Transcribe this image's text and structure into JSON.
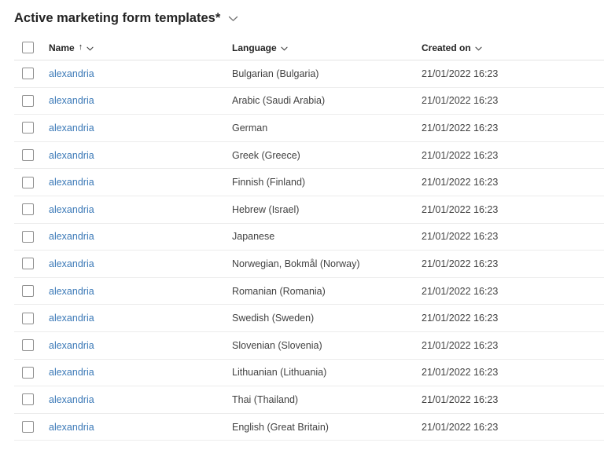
{
  "header": {
    "title": "Active marketing form templates*",
    "view_selector_icon": "chevron-down"
  },
  "icons": {
    "sort_ascending_glyph": "↑",
    "chevron_down_name": "chevron-down"
  },
  "colors": {
    "title_text": "#242424",
    "header_text": "#242424",
    "cell_text": "#424242",
    "link": "#3b79b7",
    "row_divider": "#ececec",
    "header_divider": "#e3e3e3",
    "checkbox_border": "#8f8f8f",
    "background": "#ffffff"
  },
  "table": {
    "select_all_checked": false,
    "columns": [
      {
        "id": "name",
        "label": "Name",
        "sorted": "ascending",
        "has_menu": true
      },
      {
        "id": "language",
        "label": "Language",
        "has_menu": true
      },
      {
        "id": "created_on",
        "label": "Created on",
        "has_menu": true
      }
    ],
    "rows": [
      {
        "name": "alexandria",
        "language": "Bulgarian (Bulgaria)",
        "created_on": "21/01/2022 16:23"
      },
      {
        "name": "alexandria",
        "language": "Arabic (Saudi Arabia)",
        "created_on": "21/01/2022 16:23"
      },
      {
        "name": "alexandria",
        "language": "German",
        "created_on": "21/01/2022 16:23"
      },
      {
        "name": "alexandria",
        "language": "Greek (Greece)",
        "created_on": "21/01/2022 16:23"
      },
      {
        "name": "alexandria",
        "language": "Finnish (Finland)",
        "created_on": "21/01/2022 16:23"
      },
      {
        "name": "alexandria",
        "language": "Hebrew (Israel)",
        "created_on": "21/01/2022 16:23"
      },
      {
        "name": "alexandria",
        "language": "Japanese",
        "created_on": "21/01/2022 16:23"
      },
      {
        "name": "alexandria",
        "language": "Norwegian, Bokmål (Norway)",
        "created_on": "21/01/2022 16:23"
      },
      {
        "name": "alexandria",
        "language": "Romanian (Romania)",
        "created_on": "21/01/2022 16:23"
      },
      {
        "name": "alexandria",
        "language": "Swedish (Sweden)",
        "created_on": "21/01/2022 16:23"
      },
      {
        "name": "alexandria",
        "language": "Slovenian (Slovenia)",
        "created_on": "21/01/2022 16:23"
      },
      {
        "name": "alexandria",
        "language": "Lithuanian (Lithuania)",
        "created_on": "21/01/2022 16:23"
      },
      {
        "name": "alexandria",
        "language": "Thai (Thailand)",
        "created_on": "21/01/2022 16:23"
      },
      {
        "name": "alexandria",
        "language": "English (Great Britain)",
        "created_on": "21/01/2022 16:23"
      }
    ]
  }
}
